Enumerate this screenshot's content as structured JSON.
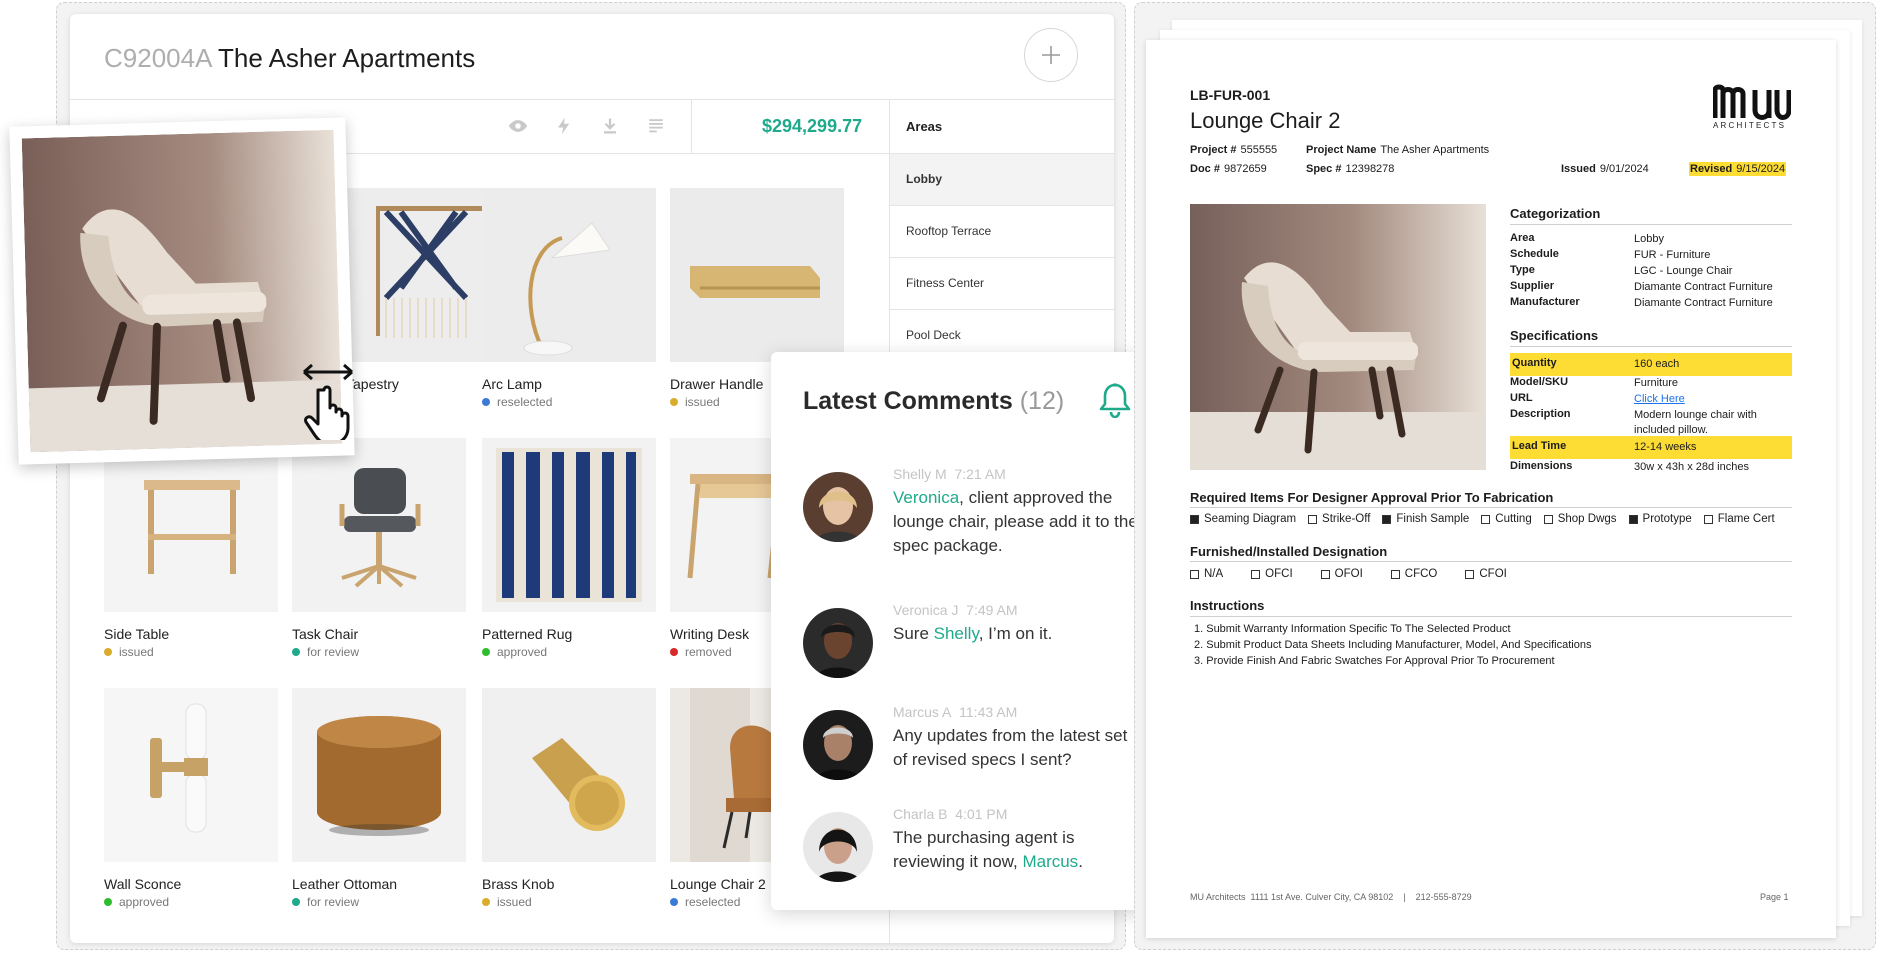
{
  "project": {
    "code": "C92004A",
    "name": "The Asher Apartments",
    "total": "$294,299.77"
  },
  "toolbar": {
    "icons": [
      "eye-icon",
      "lightning-icon",
      "download-icon",
      "list-icon"
    ]
  },
  "areas": {
    "header": "Areas",
    "items": [
      {
        "label": "Lobby",
        "active": true
      },
      {
        "label": "Rooftop Terrace",
        "active": false
      },
      {
        "label": "Fitness Center",
        "active": false
      },
      {
        "label": "Pool Deck",
        "active": false
      }
    ]
  },
  "status_colors": {
    "issued": "#d9ad2b",
    "reselected": "#3a7bd5",
    "for review": "#1eaa8b",
    "approved": "#2fbd2f",
    "removed": "#d62a2a"
  },
  "products": [
    {
      "name": "Tapestry",
      "status": ""
    },
    {
      "name": "Arc Lamp",
      "status": "reselected"
    },
    {
      "name": "Drawer Handle",
      "status": "issued"
    },
    {
      "name": "Side Table",
      "status": "issued"
    },
    {
      "name": "Task Chair",
      "status": "for review"
    },
    {
      "name": "Patterned Rug",
      "status": "approved"
    },
    {
      "name": "Writing Desk",
      "status": "removed"
    },
    {
      "name": "Wall Sconce",
      "status": "approved"
    },
    {
      "name": "Leather Ottoman",
      "status": "for review"
    },
    {
      "name": "Brass Knob",
      "status": "issued"
    },
    {
      "name": "Lounge Chair 2",
      "status": "reselected"
    }
  ],
  "comments": {
    "title": "Latest Comments",
    "count": "(12)",
    "items": [
      {
        "author": "Shelly M",
        "time": "7:21 AM",
        "mention": "Veronica",
        "text_before": "",
        "text_after": ", client approved the lounge chair, please add it to the spec package."
      },
      {
        "author": "Veronica J",
        "time": "7:49 AM",
        "mention": "Shelly",
        "text_before": "Sure ",
        "text_after": ", I’m on it."
      },
      {
        "author": "Marcus A",
        "time": "11:43 AM",
        "mention": "",
        "text_before": "Any updates from the latest set of revised specs I sent?",
        "text_after": ""
      },
      {
        "author": "Charla B",
        "time": "4:01 PM",
        "mention": "Marcus",
        "text_before": "The purchasing agent is reviewing it now, ",
        "text_after": "."
      }
    ]
  },
  "document": {
    "code": "LB-FUR-001",
    "title": "Lounge Chair 2",
    "logo": {
      "mark": "MU",
      "sub": "ARCHITECTS"
    },
    "project_no_label": "Project #",
    "project_no": "555555",
    "project_name_label": "Project Name",
    "project_name": "The Asher Apartments",
    "doc_no_label": "Doc #",
    "doc_no": "9872659",
    "spec_no_label": "Spec #",
    "spec_no": "12398278",
    "issued_label": "Issued",
    "issued": "9/01/2024",
    "revised_label": "Revised",
    "revised": "9/15/2024",
    "categorization": {
      "title": "Categorization",
      "rows": [
        {
          "k": "Area",
          "v": "Lobby"
        },
        {
          "k": "Schedule",
          "v": "FUR - Furniture"
        },
        {
          "k": "Type",
          "v": "LGC - Lounge Chair"
        },
        {
          "k": "Supplier",
          "v": "Diamante Contract Furniture"
        },
        {
          "k": "Manufacturer",
          "v": "Diamante Contract Furniture"
        }
      ]
    },
    "specifications": {
      "title": "Specifications",
      "rows": [
        {
          "k": "Quantity",
          "v": "160 each",
          "highlight": true
        },
        {
          "k": "Model/SKU",
          "v": "Furniture",
          "highlight": false
        },
        {
          "k": "URL",
          "v": "Click Here",
          "highlight": false
        },
        {
          "k": "Description",
          "v": "Modern lounge chair with included pillow.",
          "highlight": false
        },
        {
          "k": "Lead Time",
          "v": "12-14 weeks",
          "highlight": true
        },
        {
          "k": "Dimensions",
          "v": "30w x 43h x 28d inches",
          "highlight": false
        }
      ]
    },
    "required": {
      "title": "Required Items For Designer Approval Prior To Fabrication",
      "items": [
        {
          "label": "Seaming Diagram",
          "checked": true
        },
        {
          "label": "Strike-Off",
          "checked": false
        },
        {
          "label": "Finish Sample",
          "checked": true
        },
        {
          "label": "Cutting",
          "checked": false
        },
        {
          "label": "Shop Dwgs",
          "checked": false
        },
        {
          "label": "Prototype",
          "checked": true
        },
        {
          "label": "Flame Cert",
          "checked": false
        }
      ]
    },
    "furnished": {
      "title": "Furnished/Installed Designation",
      "items": [
        {
          "label": "N/A",
          "checked": false
        },
        {
          "label": "OFCI",
          "checked": false
        },
        {
          "label": "OFOI",
          "checked": false
        },
        {
          "label": "CFCO",
          "checked": false
        },
        {
          "label": "CFOI",
          "checked": false
        }
      ]
    },
    "instructions": {
      "title": "Instructions",
      "items": [
        "1. Submit Warranty Information Specific To The Selected Product",
        "2. Submit Product Data Sheets Including Manufacturer, Model, And Specifications",
        "3. Provide Finish And Fabric Swatches For Approval Prior To Procurement"
      ]
    },
    "footer": {
      "address": "MU Architects  1111 1st Ave. Culver City, CA 98102    |    212-555-8729",
      "page": "Page 1"
    }
  }
}
